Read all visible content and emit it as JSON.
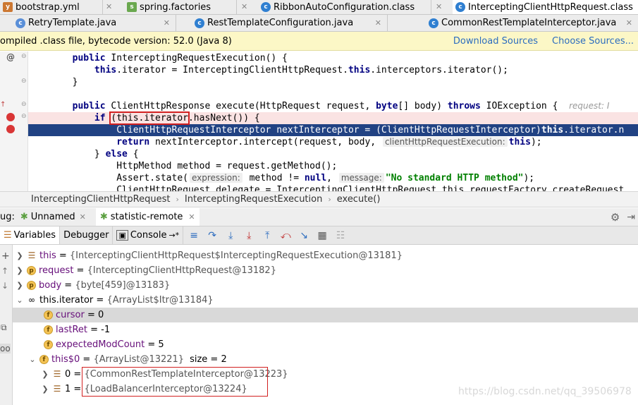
{
  "tabs_row1": [
    {
      "label": "bootstrap.yml",
      "icon": "yaml-file-icon"
    },
    {
      "label": "spring.factories",
      "icon": "spring-file-icon"
    },
    {
      "label": "RibbonAutoConfiguration.class",
      "icon": "class-file-icon"
    },
    {
      "label": "InterceptingClientHttpRequest.class",
      "icon": "class-file-icon"
    }
  ],
  "tabs_row2": [
    {
      "label": "RetryTemplate.java",
      "icon": "java-file-icon"
    },
    {
      "label": "RestTemplateConfiguration.java",
      "icon": "class-file-icon"
    },
    {
      "label": "CommonRestTemplateInterceptor.java",
      "icon": "class-file-icon"
    }
  ],
  "decompiled_banner": {
    "message": "ompiled .class file, bytecode version: 52.0 (Java 8)",
    "download_sources": "Download Sources",
    "choose_sources": "Choose Sources..."
  },
  "code": {
    "l1_kw": "public",
    "l1_rest": " InterceptingRequestExecution() {",
    "l2_kw": "this",
    "l2_a": ".iterator = InterceptingClientHttpRequest.",
    "l2_kw2": "this",
    "l2_b": ".interceptors.iterator();",
    "l3": "}",
    "l4_kw": "public",
    "l4_a": " ClientHttpResponse execute(HttpRequest request, ",
    "l4_kw2": "byte",
    "l4_b": "[] body) ",
    "l4_kw3": "throws",
    "l4_c": " IOException {",
    "l4_hint": "request: I",
    "l5_kw": "if",
    "l5_box": "(this.iterator",
    "l5_rest": ".hasNext()) {",
    "l6": "ClientHttpRequestInterceptor nextInterceptor = (ClientHttpRequestInterceptor)",
    "l6_kw": "this",
    "l6_rest": ".iterator.n",
    "l7_kw": "return",
    "l7_a": " nextInterceptor.intercept(request, body, ",
    "l7_hint": "clientHttpRequestExecution:",
    "l7_kw2": "this",
    "l7_b": ");",
    "l8_a": "} ",
    "l8_kw": "else",
    "l8_b": " {",
    "l9": "HttpMethod method = request.getMethod();",
    "l10_a": "Assert.state(",
    "l10_hint1": "expression:",
    "l10_b": " method != ",
    "l10_kw": "null",
    "l10_c": ", ",
    "l10_hint2": "message:",
    "l10_str": "\"No standard HTTP method\"",
    "l10_d": ");",
    "l11": "ClientHttpRequest delegate = InterceptingClientHttpRequest.this.requestFactory.createRequest"
  },
  "breadcrumb": [
    "InterceptingClientHttpRequest",
    "InterceptingRequestExecution",
    "execute()"
  ],
  "debug": {
    "label": "ug:",
    "sessions": [
      "Unnamed",
      "statistic-remote"
    ],
    "tabs": {
      "variables": "Variables",
      "debugger": "Debugger",
      "console": "Console",
      "console_suffix": "→*"
    }
  },
  "variables": [
    {
      "name": "this",
      "value": "{InterceptingClientHttpRequest$InterceptingRequestExecution@13181}"
    },
    {
      "name": "request",
      "value": "{InterceptingClientHttpRequest@13182}"
    },
    {
      "name": "body",
      "value": "{byte[459]@13183}"
    },
    {
      "name": "this.iterator",
      "value": "{ArrayList$Itr@13184}"
    },
    {
      "name": "cursor",
      "value": "0"
    },
    {
      "name": "lastRet",
      "value": "-1"
    },
    {
      "name": "expectedModCount",
      "value": "5"
    },
    {
      "name": "this$0",
      "value": "{ArrayList@13221}",
      "extra": "size = 2"
    },
    {
      "name": "0",
      "value": "{CommonRestTemplateInterceptor@13223}"
    },
    {
      "name": "1",
      "value": "{LoadBalancerInterceptor@13224}"
    }
  ],
  "watermark": "https://blog.csdn.net/qq_39506978",
  "colors": {
    "selection": "#214283",
    "breakpoint": "#d93636",
    "annotation_box": "#d22020"
  }
}
